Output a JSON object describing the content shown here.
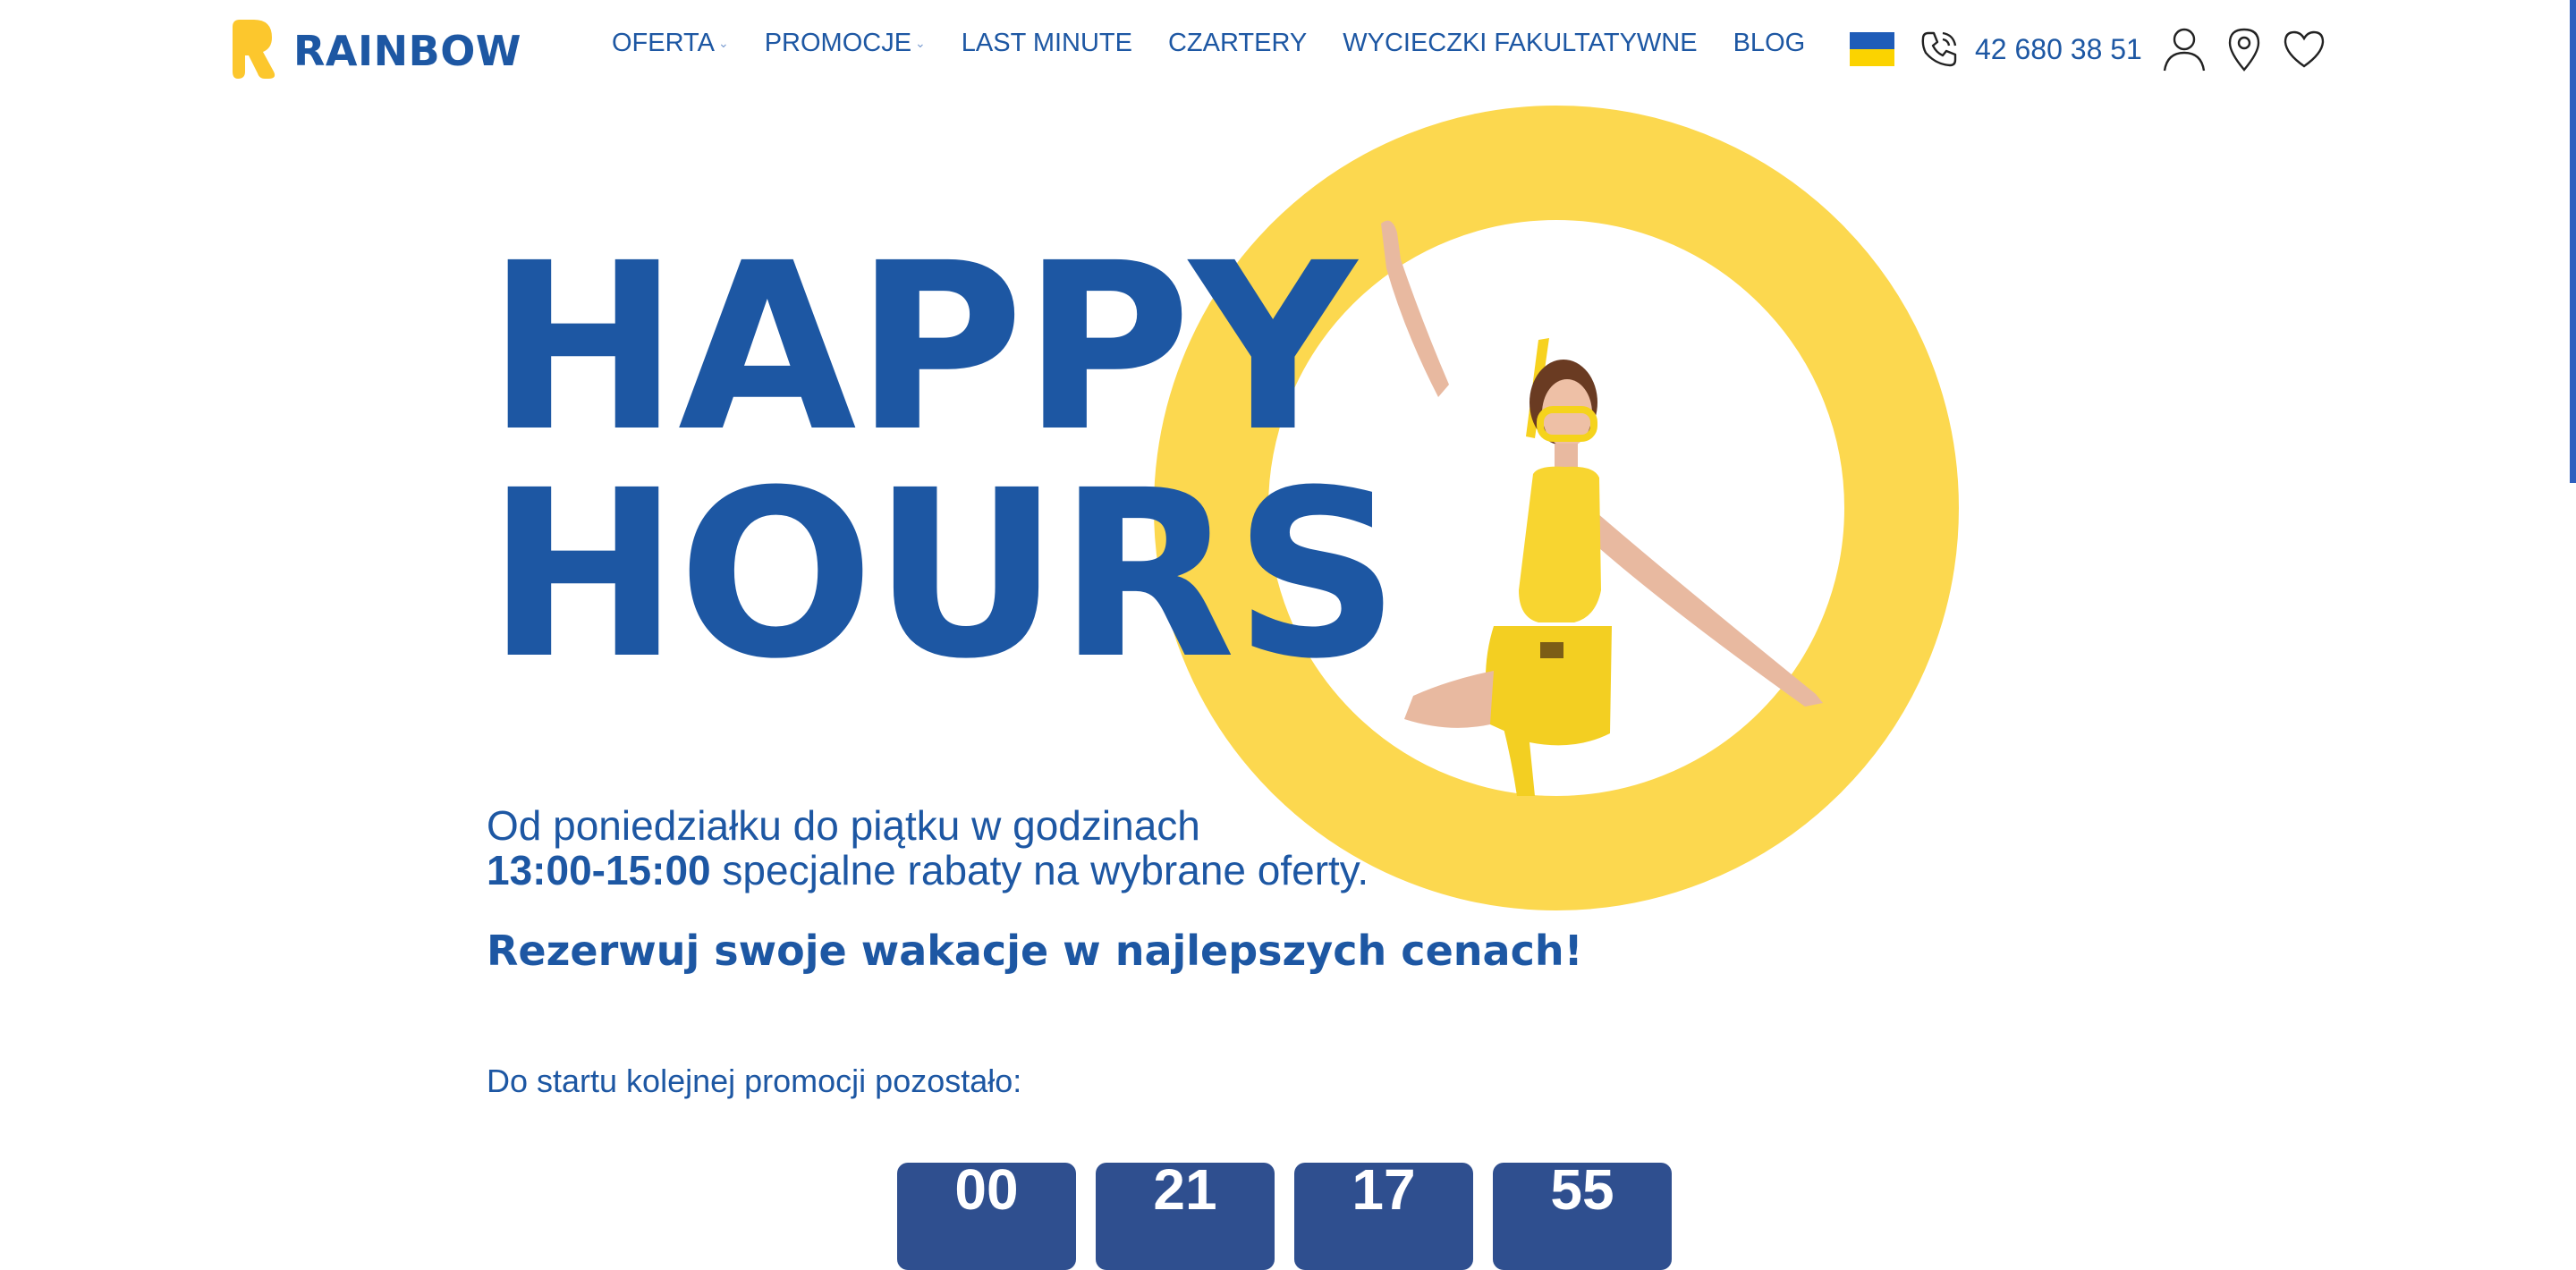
{
  "brand": {
    "name": "RAINBOW"
  },
  "nav": [
    {
      "label": "OFERTA",
      "has_dropdown": true
    },
    {
      "label": "PROMOCJE",
      "has_dropdown": true
    },
    {
      "label": "LAST MINUTE",
      "has_dropdown": false
    },
    {
      "label": "CZARTERY",
      "has_dropdown": false
    },
    {
      "label": "WYCIECZKI FAKULTATYWNE",
      "has_dropdown": false
    },
    {
      "label": "BLOG",
      "has_dropdown": false
    }
  ],
  "tools": {
    "phone": "42 680 38 51",
    "icons": [
      "ukraine-flag",
      "phone-icon",
      "user-icon",
      "location-pin-icon",
      "heart-icon"
    ]
  },
  "hero": {
    "headline_line1": "HAPPY",
    "headline_line2": "HOURS",
    "sub_line1": "Od poniedziałku do piątku w godzinach",
    "sub_hours": "13:00-15:00",
    "sub_rest": " specjalne rabaty na wybrane oferty.",
    "cta": "Rezerwuj swoje wakacje w najlepszych cenach!",
    "countdown_label": "Do startu kolejnej promocji pozostało:",
    "countdown": [
      "00",
      "21",
      "17",
      "55"
    ]
  },
  "colors": {
    "brand_blue": "#1d57a3",
    "brand_yellow": "#fcd84f",
    "countdown_bg": "#2f4f8f"
  }
}
